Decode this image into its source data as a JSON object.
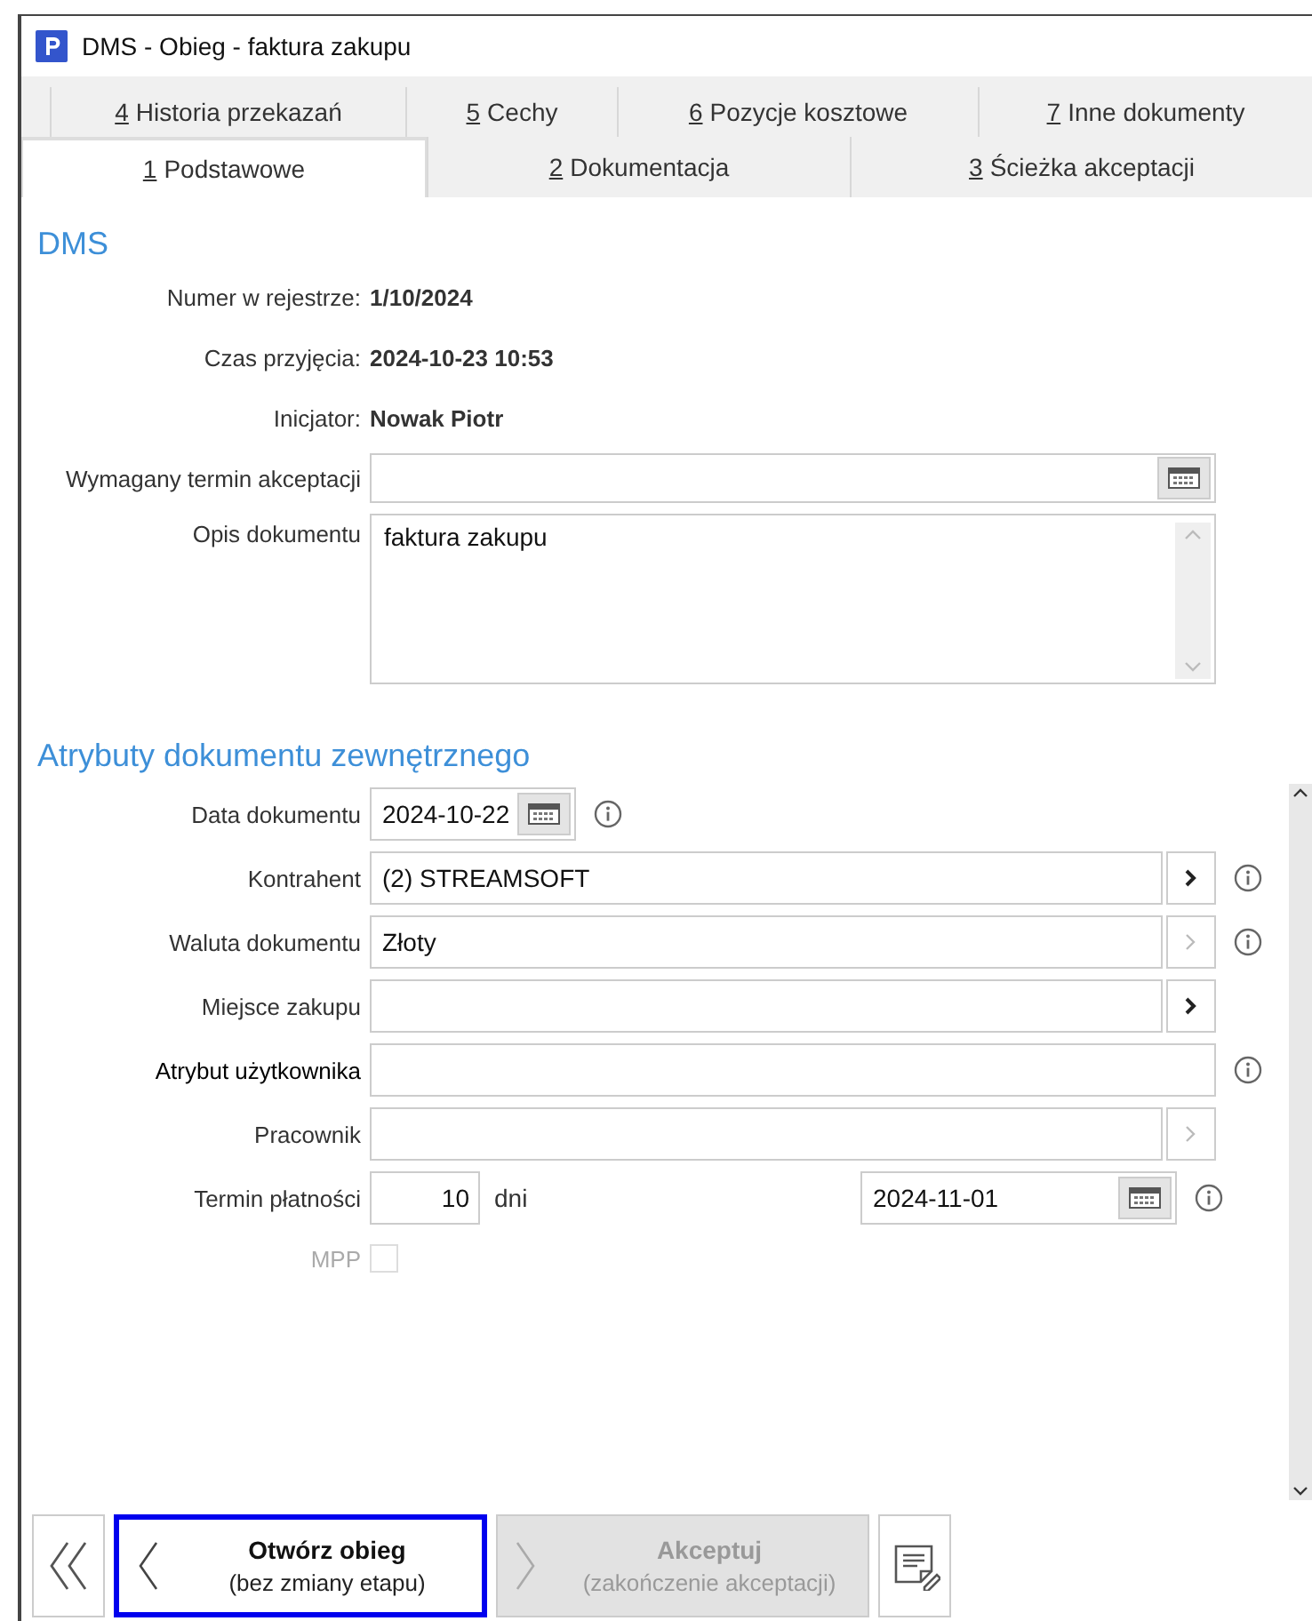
{
  "window": {
    "title": "DMS - Obieg - faktura zakupu"
  },
  "tabs": [
    [
      {
        "key": "4",
        "label": "Historia przekazań",
        "selected": false
      },
      {
        "key": "5",
        "label": "Cechy",
        "selected": false
      },
      {
        "key": "6",
        "label": "Pozycje kosztowe",
        "selected": false
      },
      {
        "key": "7",
        "label": "Inne dokumenty",
        "selected": false
      }
    ],
    [
      {
        "key": "1",
        "label": "Podstawowe",
        "selected": true
      },
      {
        "key": "2",
        "label": "Dokumentacja",
        "selected": false
      },
      {
        "key": "3",
        "label": "Ścieżka akceptacji",
        "selected": false
      }
    ]
  ],
  "dms": {
    "heading": "DMS",
    "info_rows": [
      {
        "label": "Numer w rejestrze:",
        "value": "1/10/2024"
      },
      {
        "label": "Czas przyjęcia:",
        "value": "2024-10-23 10:53"
      },
      {
        "label": "Inicjator:",
        "value": "Nowak Piotr"
      }
    ],
    "deadline_field": {
      "label": "Wymagany termin akceptacji"
    },
    "description": {
      "label": "Opis dokumentu",
      "value": "faktura zakupu"
    }
  },
  "attributes": {
    "heading": "Atrybuty dokumentu zewnętrznego",
    "rows": [
      {
        "kind": "date",
        "label": "Data dokumentu",
        "value": "2024-10-22",
        "info": true
      },
      {
        "kind": "lookup",
        "label": "Kontrahent",
        "value": "(2) STREAMSOFT",
        "disabled": false,
        "info": true
      },
      {
        "kind": "lookup",
        "label": "Waluta dokumentu",
        "value": "Złoty",
        "disabled": true,
        "info": true
      },
      {
        "kind": "lookup",
        "label": "Miejsce zakupu",
        "disabled": false,
        "info": false
      },
      {
        "kind": "text",
        "label": "Atrybut użytkownika",
        "info": true
      },
      {
        "kind": "lookup",
        "label": "Pracownik",
        "disabled": true,
        "info": false
      },
      {
        "kind": "payment",
        "label": "Termin płatności",
        "days": "10",
        "unit": "dni",
        "date": "2024-11-01",
        "info": true
      },
      {
        "kind": "checkbox",
        "label": "MPP",
        "checked": false,
        "disabled": true
      }
    ]
  },
  "actions": [
    {
      "kind": "first"
    },
    {
      "kind": "back",
      "title": "Otwórz obieg",
      "subtitle": "(bez zmiany etapu)",
      "focused": true,
      "disabled": false
    },
    {
      "kind": "forward",
      "title": "Akceptuj",
      "subtitle": "(zakończenie akceptacji)",
      "focused": false,
      "disabled": true
    },
    {
      "kind": "note"
    }
  ]
}
